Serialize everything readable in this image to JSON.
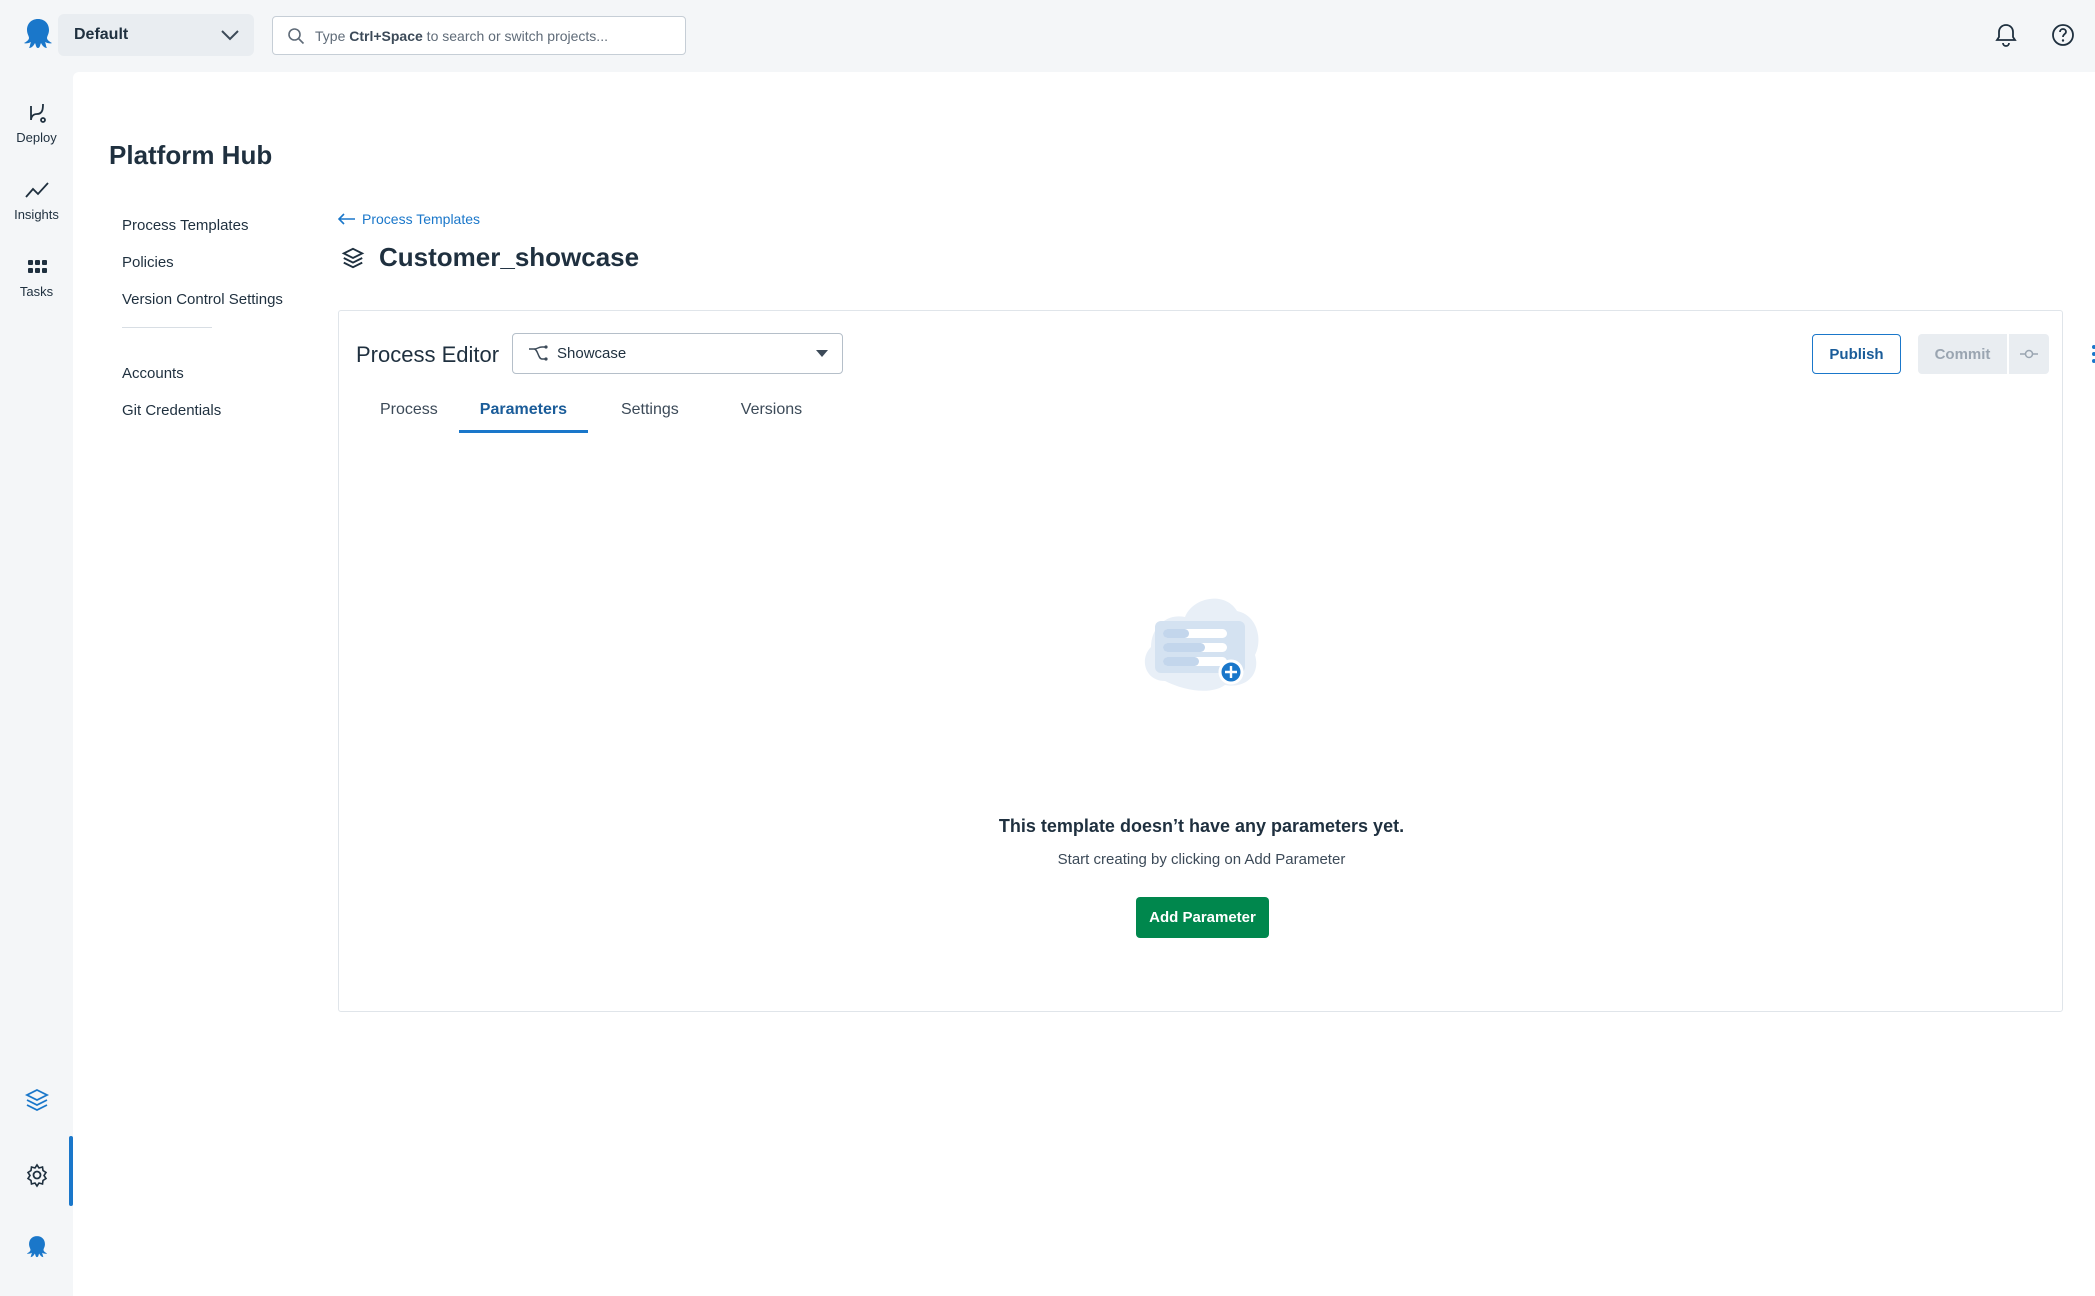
{
  "header": {
    "space": "Default",
    "search": {
      "prefix": "Type ",
      "shortcut": "Ctrl+Space",
      "suffix": " to search or switch projects..."
    }
  },
  "rail": {
    "items": [
      {
        "label": "Deploy",
        "icon": "deploy-icon"
      },
      {
        "label": "Insights",
        "icon": "insights-icon"
      },
      {
        "label": "Tasks",
        "icon": "tasks-icon"
      }
    ],
    "bottom_icons": [
      "platform-hub-icon",
      "gear-icon",
      "octopus-logo-icon"
    ]
  },
  "page": {
    "title": "Platform Hub",
    "subnav": {
      "group1": [
        "Process Templates",
        "Policies",
        "Version Control Settings"
      ],
      "group2": [
        "Accounts",
        "Git Credentials"
      ]
    },
    "back_link": "Process Templates",
    "template_name": "Customer_showcase"
  },
  "editor": {
    "heading": "Process Editor",
    "selected_process": "Showcase",
    "publish": "Publish",
    "commit": "Commit",
    "tabs": [
      "Process",
      "Parameters",
      "Settings",
      "Versions"
    ],
    "active_tab": "Parameters",
    "empty_title": "This template doesn’t have any parameters yet.",
    "empty_sub": "Start creating by clicking on Add Parameter",
    "add_button": "Add Parameter"
  },
  "colors": {
    "accent": "#1a77ca",
    "primary_button": "#00874d",
    "background": "#f4f6f8"
  }
}
